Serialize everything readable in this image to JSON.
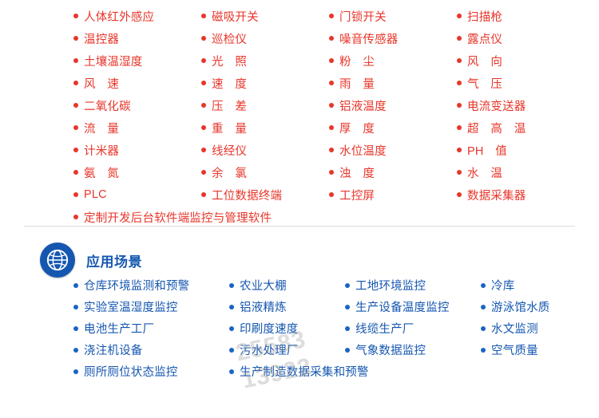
{
  "products": {
    "accent_color": "#e8352a",
    "items": [
      "人体红外感应",
      "磁吸开关",
      "门锁开关",
      "扫描枪",
      "温控器",
      "巡检仪",
      "噪音传感器",
      "露点仪",
      "土壤温湿度",
      "光　照",
      "粉　尘",
      "风　向",
      "风　速",
      "速　度",
      "雨　量",
      "气　压",
      "二氧化碳",
      "压　差",
      "铝液温度",
      "电流变送器",
      "流　量",
      "重　量",
      "厚　度",
      "超　高　温",
      "计米器",
      "线经仪",
      "水位温度",
      "PH　值",
      "氨　氮",
      "余　氯",
      "浊　度",
      "水　温",
      "PLC",
      "工位数据终端",
      "工控屏",
      "数据采集器"
    ],
    "wide_item": "定制开发后台软件端监控与管理软件"
  },
  "scenes": {
    "accent_color": "#1557b0",
    "icon": "globe-icon",
    "title": "应用场景",
    "items": [
      "仓库环境监测和预警",
      "农业大棚",
      "工地环境监控",
      "冷库",
      "实验室温湿度监控",
      "铝液精炼",
      "生产设备温度监控",
      "游泳馆水质",
      "电池生产工厂",
      "印刷度速度",
      "线缆生产厂",
      "水文监测",
      "浇注机设备",
      "污水处理厂",
      "气象数据监控",
      "空气质量",
      "厕所厕位状态监控",
      "生产制造数据采集和预警"
    ]
  },
  "watermark": {
    "line1": "25583",
    "line2": "13922"
  }
}
